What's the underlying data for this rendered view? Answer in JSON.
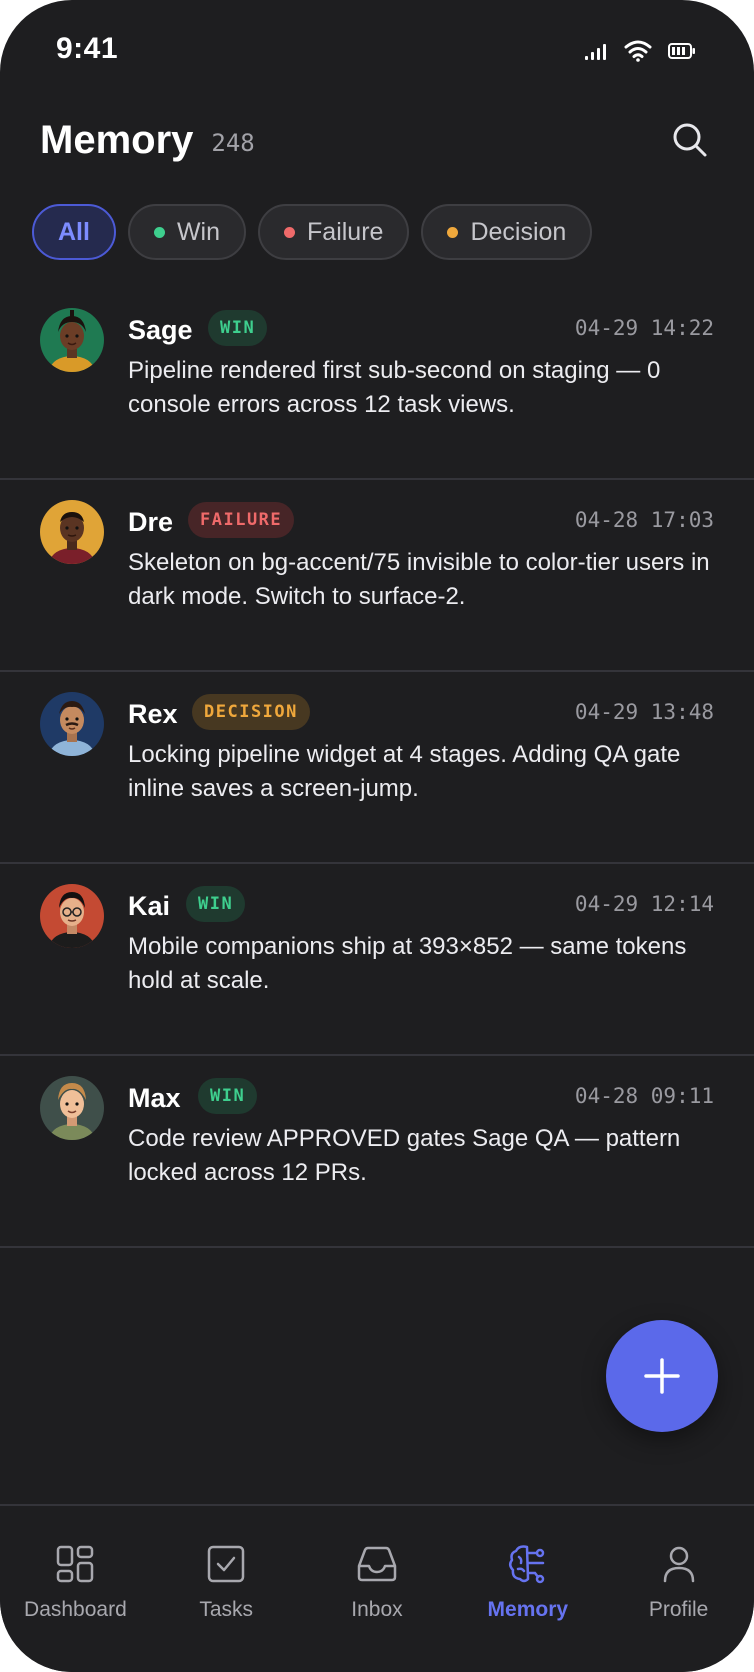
{
  "status_bar": {
    "time": "9:41",
    "icons": [
      "signal-icon",
      "wifi-icon",
      "battery-icon"
    ]
  },
  "header": {
    "title": "Memory",
    "count": "248",
    "search_icon": "search-icon"
  },
  "filters": [
    {
      "label": "All",
      "active": true
    },
    {
      "label": "Win",
      "dot_color": "#3ecf8e"
    },
    {
      "label": "Failure",
      "dot_color": "#ef6a6a"
    },
    {
      "label": "Decision",
      "dot_color": "#f0a83c"
    }
  ],
  "entries": [
    {
      "author": "Sage",
      "badge": "WIN",
      "type": "win",
      "timestamp": "04-29 14:22",
      "text": "Pipeline rendered first sub-second on staging — 0 console errors across 12 task views."
    },
    {
      "author": "Dre",
      "badge": "FAILURE",
      "type": "failure",
      "timestamp": "04-28 17:03",
      "text": "Skeleton on bg-accent/75 invisible to color-tier users in dark mode. Switch to surface-2."
    },
    {
      "author": "Rex",
      "badge": "DECISION",
      "type": "decision",
      "timestamp": "04-29 13:48",
      "text": "Locking pipeline widget at 4 stages. Adding QA gate inline saves a screen-jump."
    },
    {
      "author": "Kai",
      "badge": "WIN",
      "type": "win",
      "timestamp": "04-29 12:14",
      "text": "Mobile companions ship at 393×852 — same tokens hold at scale."
    },
    {
      "author": "Max",
      "badge": "WIN",
      "type": "win",
      "timestamp": "04-28 09:11",
      "text": "Code review APPROVED gates Sage QA — pattern locked across 12 PRs."
    }
  ],
  "fab": {
    "icon": "plus-icon"
  },
  "nav": [
    {
      "label": "Dashboard",
      "icon": "dashboard-icon"
    },
    {
      "label": "Tasks",
      "icon": "tasks-icon"
    },
    {
      "label": "Inbox",
      "icon": "inbox-icon"
    },
    {
      "label": "Memory",
      "icon": "brain-icon",
      "active": true
    },
    {
      "label": "Profile",
      "icon": "profile-icon"
    }
  ],
  "colors": {
    "background": "#1e1e20",
    "accent": "#5b69ea",
    "win": "#3ecf8e",
    "failure": "#ef6a6a",
    "decision": "#f0a83c"
  }
}
